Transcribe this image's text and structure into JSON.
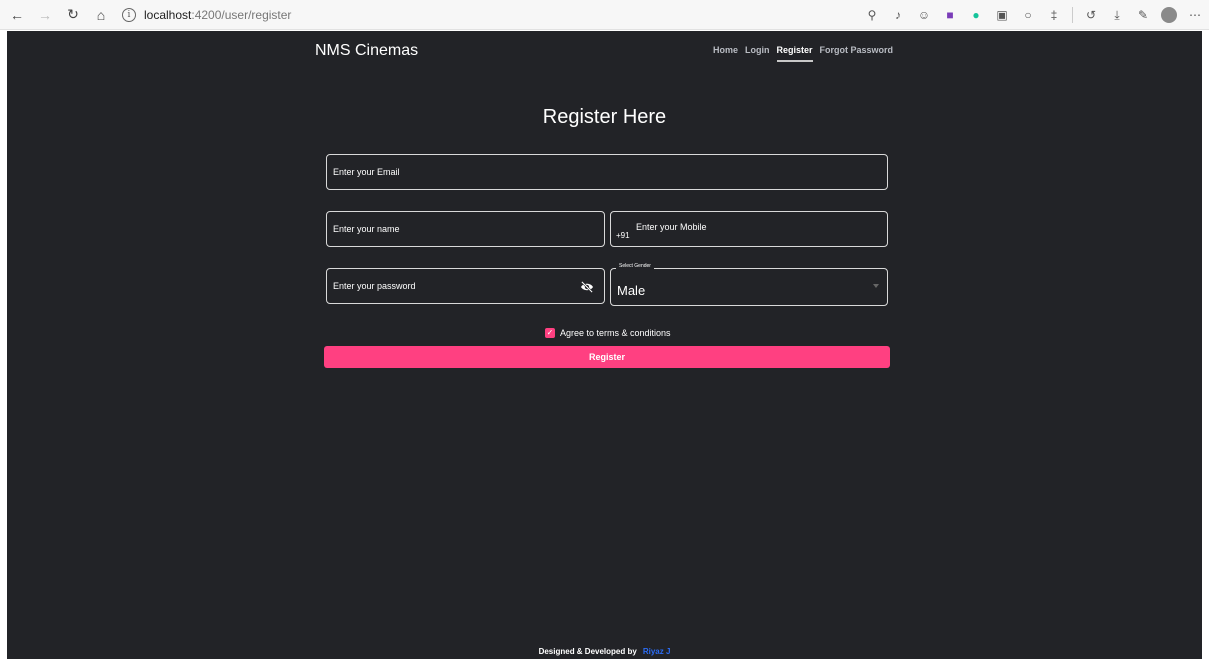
{
  "browser": {
    "url_host": "localhost",
    "url_path": ":4200/user/register"
  },
  "app": {
    "brand": "NMS Cinemas",
    "nav": [
      {
        "label": "Home"
      },
      {
        "label": "Login"
      },
      {
        "label": "Register"
      },
      {
        "label": "Forgot Password"
      }
    ],
    "active_nav": "Register"
  },
  "form": {
    "title": "Register Here",
    "email_placeholder": "Enter your Email",
    "name_placeholder": "Enter your name",
    "mobile_prefix": "+91",
    "mobile_placeholder": "Enter your Mobile",
    "password_placeholder": "Enter your password",
    "gender_label": "Select Gender",
    "gender_value": "Male",
    "agree_label": "Agree to terms & conditions",
    "agree_checked": true,
    "submit_label": "Register"
  },
  "footer": {
    "text": "Designed & Developed by",
    "author": "Riyaz J"
  },
  "colors": {
    "background": "#222327",
    "accent": "#ff4081",
    "link": "#2b6cf5"
  }
}
